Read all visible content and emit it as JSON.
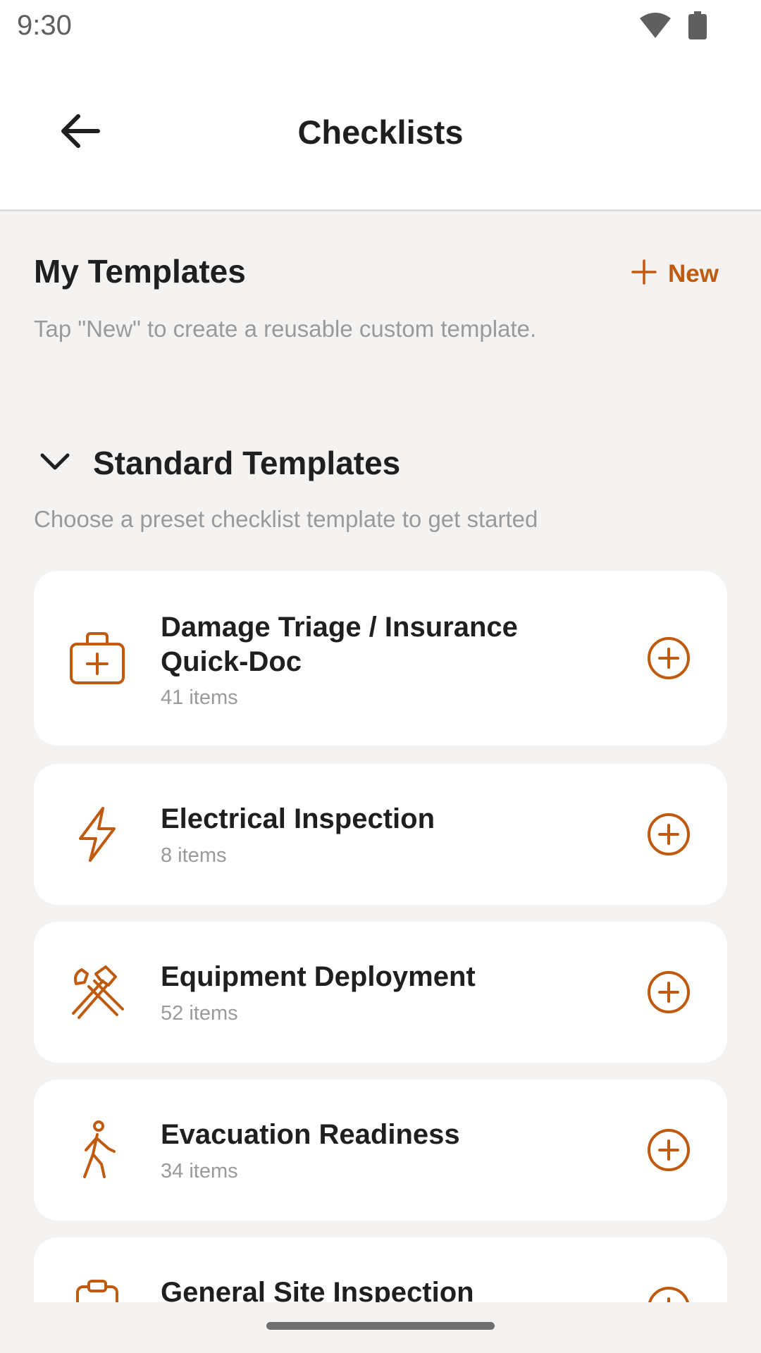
{
  "status": {
    "time": "9:30"
  },
  "appbar": {
    "title": "Checklists"
  },
  "my_templates": {
    "heading": "My Templates",
    "new_label": "New",
    "hint": "Tap \"New\" to create a reusable custom template."
  },
  "standard": {
    "heading": "Standard Templates",
    "hint": "Choose a preset checklist template to get started",
    "templates": [
      {
        "title": "Damage Triage / Insurance Quick-Doc",
        "count": "41 items",
        "icon": "first-aid-kit-icon"
      },
      {
        "title": "Electrical Inspection",
        "count": "8 items",
        "icon": "lightning-bolt-icon"
      },
      {
        "title": "Equipment Deployment",
        "count": "52 items",
        "icon": "hammer-wrench-icon"
      },
      {
        "title": "Evacuation Readiness",
        "count": "34 items",
        "icon": "walking-person-icon"
      },
      {
        "title": "General Site Inspection",
        "count": "",
        "icon": "clipboard-icon"
      }
    ]
  },
  "colors": {
    "accent": "#c05a0e",
    "background": "#f4f3f1",
    "card": "#ffffff"
  }
}
